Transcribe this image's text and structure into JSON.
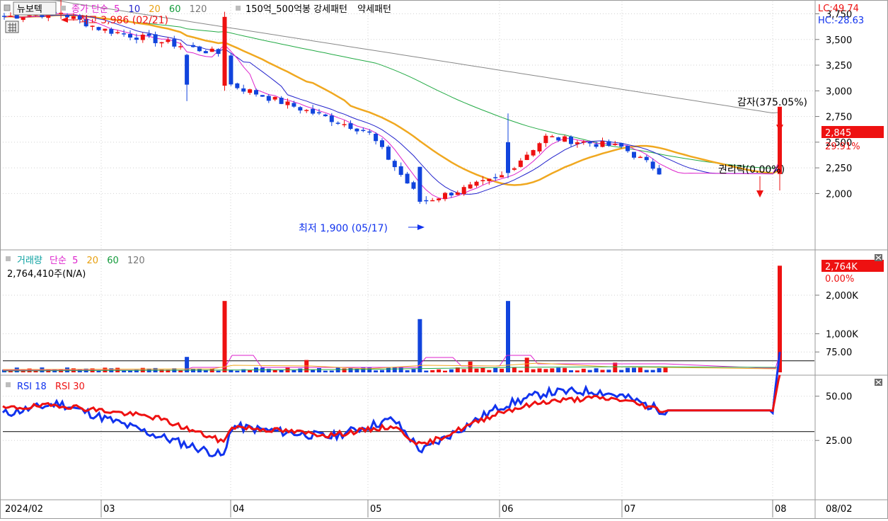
{
  "header": {
    "stock_name": "뉴보텍",
    "ma_label": "종가 단순",
    "ma_periods": [
      "5",
      "10",
      "20",
      "60",
      "120"
    ],
    "pattern_label": "150억_500억봉 강세패턴",
    "pattern_label2": "약세패턴"
  },
  "right_info": {
    "lc": "LC:49.74",
    "hc": "HC:-28.63"
  },
  "price_panel": {
    "current_price": "2,845",
    "change_pct": "29.91%",
    "high_annotation": "최고 3,986 (02/21)",
    "low_annotation": "최저 1,900 (05/17)",
    "gamja_annotation": "감자(375.05%)",
    "rights_annotation": "권리락(0.00%)",
    "y_ticks": [
      "3,750",
      "3,500",
      "3,250",
      "3,000",
      "2,750",
      "2,500",
      "2,250",
      "2,000"
    ]
  },
  "volume_panel": {
    "title": "거래량",
    "ma_label": "단순",
    "ma_periods": [
      "5",
      "20",
      "60",
      "120"
    ],
    "volume_text": "2,764,410주(N/A)",
    "current_volume": "2,764K",
    "change_pct": "0.00%",
    "y_ticks": [
      "2,000K",
      "1,000K"
    ]
  },
  "rsi_panel": {
    "label1": "RSI 18",
    "label2": "RSI 30",
    "y_ticks": [
      "75.00",
      "50.00",
      "25.00"
    ]
  },
  "x_axis": {
    "labels": [
      "2024/02",
      "03",
      "04",
      "05",
      "06",
      "07",
      "08"
    ],
    "right_label": "08/02"
  },
  "colors": {
    "up": "#ee1111",
    "down": "#1144dd",
    "ma5": "#dd22cc",
    "ma10": "#2222cc",
    "ma20": "#f0a820",
    "ma60": "#22aa44",
    "ma120": "#888888",
    "rsi18": "#1133ee",
    "rsi30": "#ee1111",
    "grid": "#d2d2d2"
  },
  "chart_data": {
    "type": "candlestick",
    "x": [
      "02/05",
      "02/21",
      "03/04",
      "03/29",
      "04/01",
      "04/30",
      "05/17",
      "06/03",
      "06/14",
      "07/01",
      "07/12",
      "08/01",
      "08/02"
    ],
    "close": [
      3720,
      3760,
      3600,
      3350,
      3060,
      2600,
      1920,
      2150,
      2550,
      2450,
      2200,
      2190,
      2845
    ],
    "high_point": {
      "x": "02/21",
      "value": 3986
    },
    "low_point": {
      "x": "05/17",
      "value": 1900
    },
    "last_close": 2845,
    "last_change_pct": 29.91,
    "last_volume": 2764410,
    "y_range": [
      1900,
      4000
    ],
    "volume_y_range": [
      0,
      2800000
    ],
    "rsi": {
      "x": [
        "02/05",
        "02/21",
        "03/15",
        "03/29",
        "04/01",
        "04/22",
        "05/08",
        "05/17",
        "06/03",
        "06/14",
        "06/25",
        "07/01",
        "07/12",
        "08/01",
        "08/02"
      ],
      "rsi18": [
        40,
        46,
        28,
        16,
        33,
        27,
        37,
        19,
        44,
        52,
        53,
        50,
        42,
        42,
        75
      ],
      "rsi30": [
        43,
        45,
        38,
        24,
        33,
        28,
        33,
        22,
        41,
        47,
        49,
        48,
        42,
        42,
        62
      ],
      "reference_lines": [
        70,
        30
      ]
    }
  }
}
